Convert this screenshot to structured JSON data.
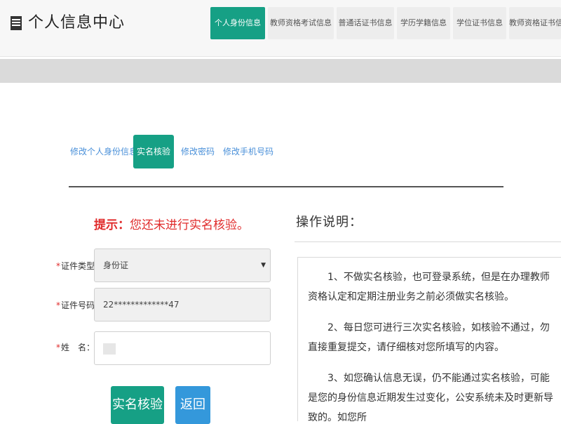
{
  "header": {
    "title": "个人信息中心",
    "tabs": [
      {
        "label": "个人身份信息",
        "active": true
      },
      {
        "label": "教师资格考试信息",
        "active": false
      },
      {
        "label": "普通话证书信息",
        "active": false
      },
      {
        "label": "学历学籍信息",
        "active": false
      },
      {
        "label": "学位证书信息",
        "active": false
      },
      {
        "label": "教师资格证书信息",
        "active": false
      }
    ]
  },
  "sub_nav": [
    {
      "label": "修改个人身份信息",
      "active": false
    },
    {
      "label": "实名核验",
      "active": true
    },
    {
      "label": "修改密码",
      "active": false
    },
    {
      "label": "修改手机号码",
      "active": false
    }
  ],
  "hint": {
    "prefix": "提示：",
    "message": "您还未进行实名核验。"
  },
  "form": {
    "id_type": {
      "label": "证件类型：",
      "value": "身份证"
    },
    "id_number": {
      "label": "证件号码：",
      "value": "22*************47"
    },
    "name": {
      "label": "姓　名：",
      "value": ""
    }
  },
  "buttons": {
    "verify": "实名核验",
    "back": "返回"
  },
  "ops": {
    "title": "操作说明：",
    "items": [
      "1、不做实名核验，也可登录系统，但是在办理教师资格认定和定期注册业务之前必须做实名核验。",
      "2、每日您可进行三次实名核验，如核验不通过，勿直接重复提交，请仔细核对您所填写的内容。",
      "3、如您确认信息无误，仍不能通过实名核验，可能是您的身份信息近期发生过变化，公安系统未及时更新导致的。如您所"
    ]
  },
  "colors": {
    "accent": "#16a085",
    "link": "#4a90d9",
    "back_button": "#3498db",
    "warning": "#e02b2b"
  }
}
